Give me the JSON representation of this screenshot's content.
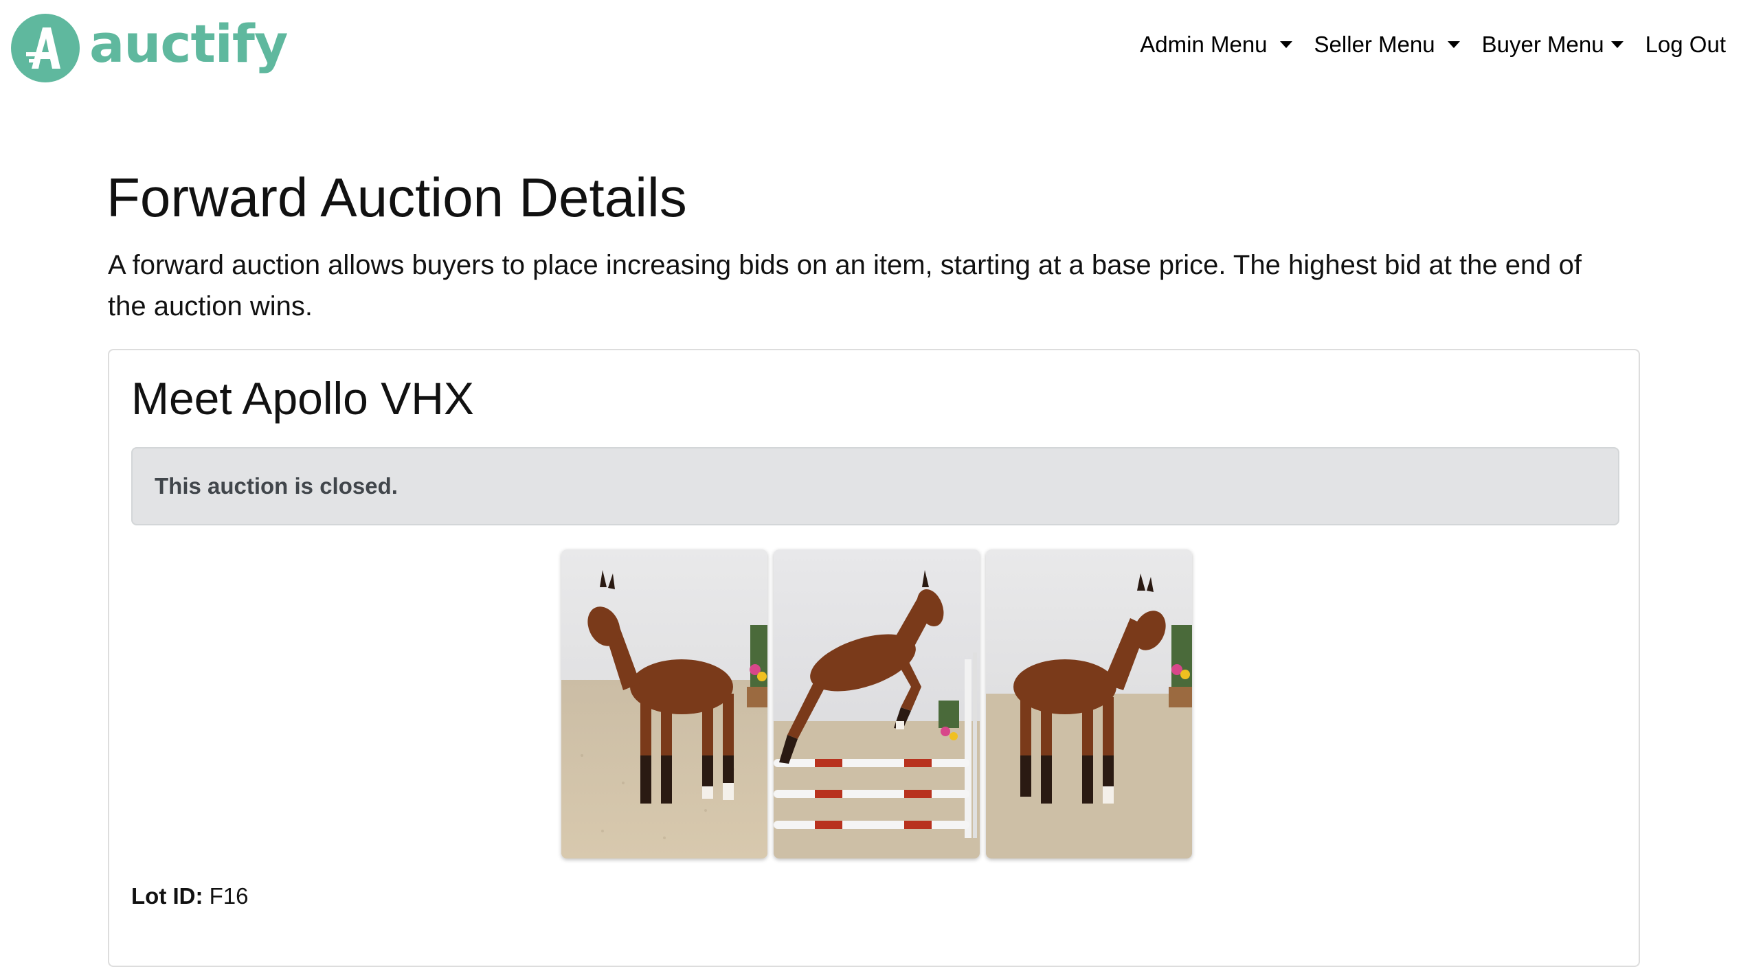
{
  "brand": {
    "name": "auctify",
    "logo_letter": "A",
    "color": "#5fb89e"
  },
  "nav": {
    "items": [
      {
        "label": "Admin Menu",
        "dropdown": true
      },
      {
        "label": "Seller Menu",
        "dropdown": true
      },
      {
        "label": "Buyer Menu",
        "dropdown": true
      },
      {
        "label": "Log Out",
        "dropdown": false
      }
    ]
  },
  "page": {
    "title": "Forward Auction Details",
    "description": "A forward auction allows buyers to place increasing bids on an item, starting at a base price. The highest bid at the end of the auction wins."
  },
  "auction": {
    "title": "Meet Apollo VHX",
    "status_message": "This auction is closed.",
    "images": [
      {
        "subject": "foal-standing-left"
      },
      {
        "subject": "foal-jumping"
      },
      {
        "subject": "foal-standing-right"
      }
    ],
    "lot_label": "Lot ID:",
    "lot_id": "F16"
  },
  "colors": {
    "alert_bg": "#e2e3e5",
    "alert_text": "#41464b",
    "coat": "#7a3a1a"
  }
}
